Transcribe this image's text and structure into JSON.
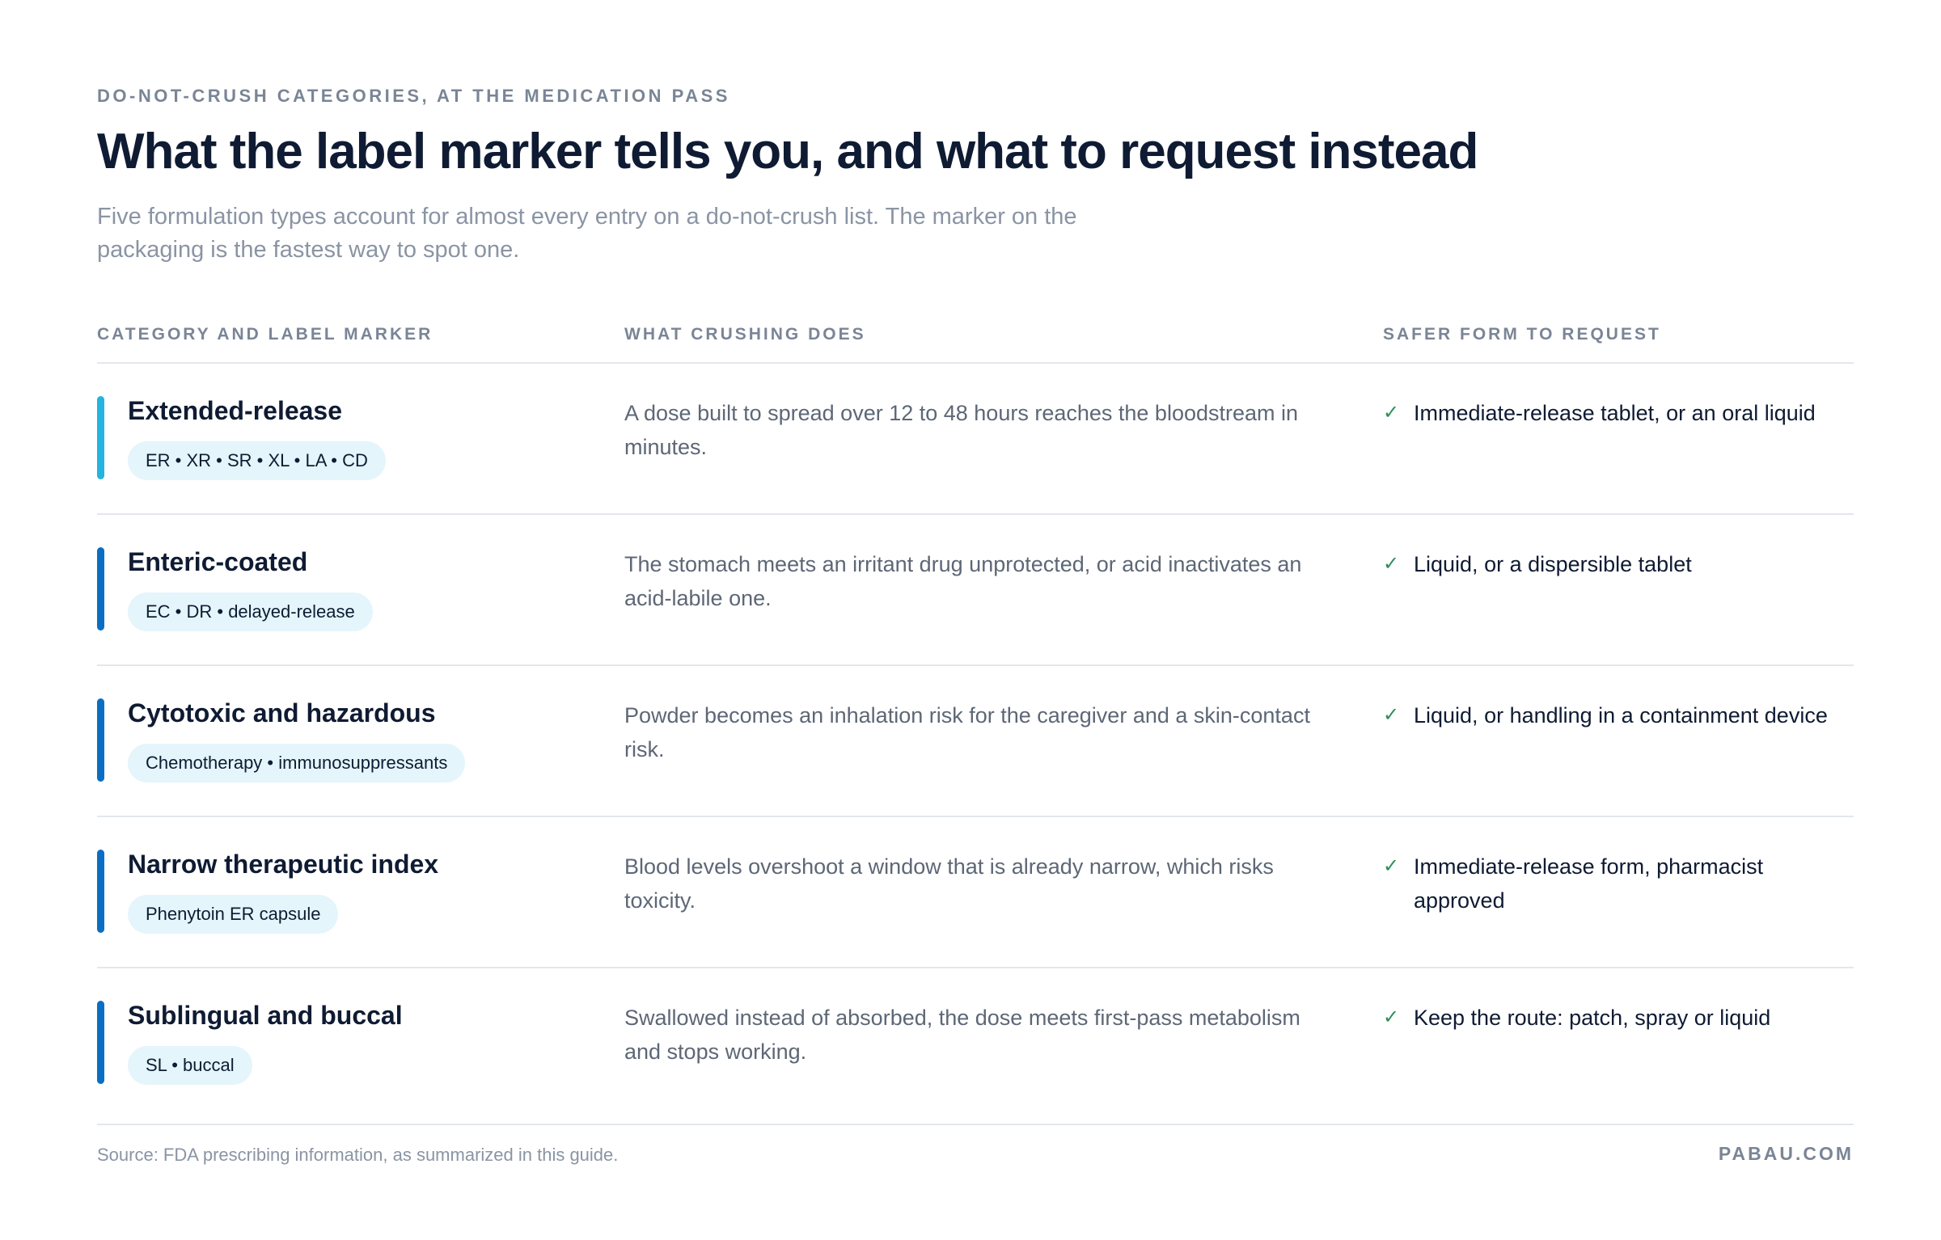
{
  "header": {
    "eyebrow": "DO-NOT-CRUSH CATEGORIES, AT THE MEDICATION PASS",
    "title": "What the label marker tells you, and what to request instead",
    "subtitle": "Five formulation types account for almost every entry on a do-not-crush list. The marker on the packaging is the fastest way to spot one."
  },
  "table": {
    "columns": [
      "CATEGORY AND LABEL MARKER",
      "WHAT CRUSHING DOES",
      "SAFER FORM TO REQUEST"
    ],
    "rows": [
      {
        "category": "Extended-release",
        "marker": "ER • XR • SR • XL • LA • CD",
        "effect": "A dose built to spread over 12 to 48 hours reaches the bloodstream in minutes.",
        "safer": "Immediate-release tablet, or an oral liquid",
        "accent": "#24b4e0"
      },
      {
        "category": "Enteric-coated",
        "marker": "EC • DR • delayed-release",
        "effect": "The stomach meets an irritant drug unprotected, or acid inactivates an acid-labile one.",
        "safer": "Liquid, or a dispersible tablet",
        "accent": "#0a6fc2"
      },
      {
        "category": "Cytotoxic and hazardous",
        "marker": "Chemotherapy • immunosuppressants",
        "effect": "Powder becomes an inhalation risk for the caregiver and a skin-contact risk.",
        "safer": "Liquid, or handling in a containment device",
        "accent": "#0a6fc2"
      },
      {
        "category": "Narrow therapeutic index",
        "marker": "Phenytoin ER capsule",
        "effect": "Blood levels overshoot a window that is already narrow, which risks toxicity.",
        "safer": "Immediate-release form, pharmacist approved",
        "accent": "#0a6fc2"
      },
      {
        "category": "Sublingual and buccal",
        "marker": "SL • buccal",
        "effect": "Swallowed instead of absorbed, the dose meets first-pass metabolism and stops working.",
        "safer": "Keep the route: patch, spray or liquid",
        "accent": "#0a6fc2"
      }
    ],
    "check_glyph": "✓"
  },
  "footer": {
    "source": "Source: FDA prescribing information, as summarized in this guide.",
    "brand": "PABAU.COM"
  }
}
